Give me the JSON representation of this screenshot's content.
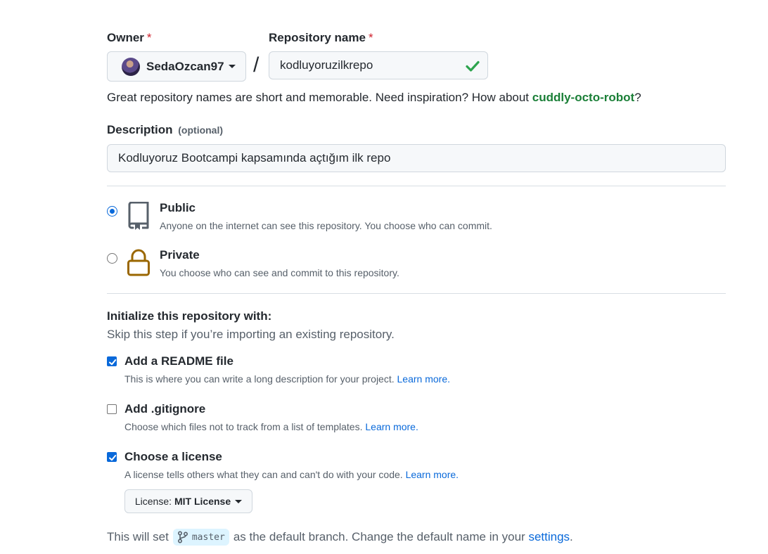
{
  "owner": {
    "label": "Owner",
    "required_mark": "*",
    "selected": "SedaOzcan97"
  },
  "separator": "/",
  "repo_name": {
    "label": "Repository name",
    "required_mark": "*",
    "value": "kodluyoruzilkrepo"
  },
  "name_hint": {
    "text": "Great repository names are short and memorable. Need inspiration? How about ",
    "suggestion": "cuddly-octo-robot",
    "end": "?"
  },
  "description": {
    "label": "Description",
    "optional": "(optional)",
    "value": "Kodluyoruz Bootcampi kapsamında açtığım ilk repo"
  },
  "visibility": {
    "selected": "public",
    "options": [
      {
        "title": "Public",
        "desc": "Anyone on the internet can see this repository. You choose who can commit.",
        "icon": "repo-icon"
      },
      {
        "title": "Private",
        "desc": "You choose who can see and commit to this repository.",
        "icon": "lock-icon"
      }
    ]
  },
  "initialize": {
    "title": "Initialize this repository with:",
    "subtitle": "Skip this step if you’re importing an existing repository.",
    "options": [
      {
        "title": "Add a README file",
        "desc": "This is where you can write a long description for your project.",
        "link": "Learn more.",
        "checked": true
      },
      {
        "title": "Add .gitignore",
        "desc": "Choose which files not to track from a list of templates.",
        "link": "Learn more.",
        "checked": false
      },
      {
        "title": "Choose a license",
        "desc": "A license tells others what they can and can't do with your code.",
        "link": "Learn more.",
        "checked": true
      }
    ]
  },
  "license_select": {
    "prefix": "License:",
    "value": "MIT License"
  },
  "default_branch": {
    "before": "This will set",
    "branch": "master",
    "after": "as the default branch. Change the default name in your",
    "link": "settings",
    "end": "."
  },
  "colors": {
    "accent": "#0969da",
    "success": "#1a7f37",
    "danger": "#cf222e",
    "lock": "#9a6700"
  }
}
